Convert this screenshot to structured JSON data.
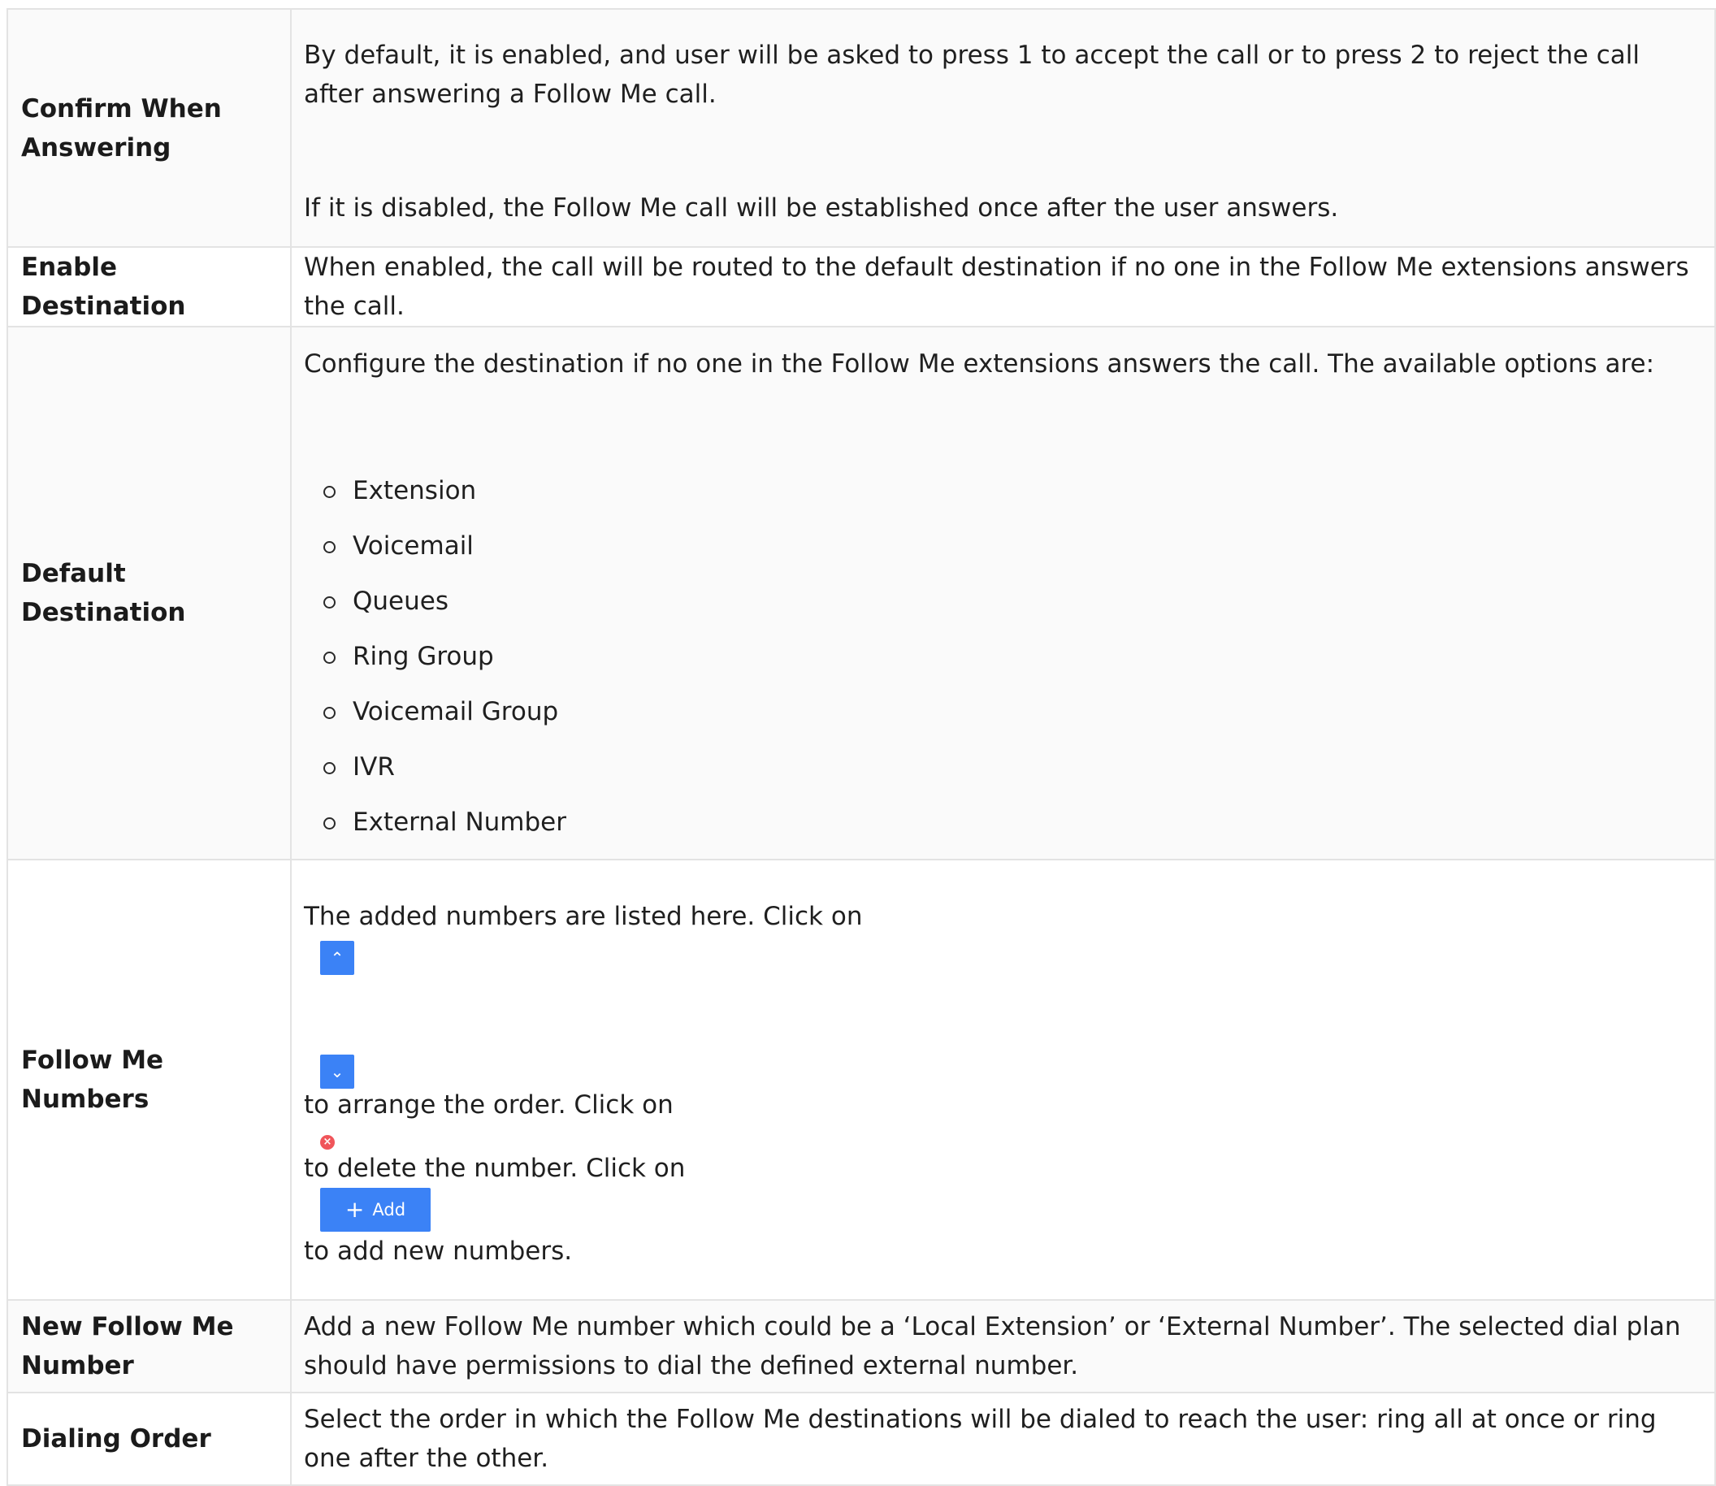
{
  "rows": [
    {
      "label": "Confirm When Answering",
      "paragraphs": [
        "By default, it is enabled, and user will be asked to press 1 to accept the call or to press 2 to reject the call after answering a Follow Me call.",
        "If it is disabled, the Follow Me call will be established once after the user answers."
      ]
    },
    {
      "label": "Enable Destination",
      "text": "When enabled, the call will be routed to the default destination if no one in the Follow Me extensions answers the call."
    },
    {
      "label": "Default Destination",
      "intro": "Configure the destination if no one in the Follow Me extensions answers the call. The available options are:",
      "options": [
        "Extension",
        "Voicemail",
        "Queues",
        "Ring Group",
        "Voicemail Group",
        "IVR",
        "External Number"
      ]
    },
    {
      "label": "Follow Me Numbers",
      "text1": "The added numbers are listed here. Click on",
      "text2": "to arrange the order. Click on",
      "text3": "to delete the number. Click on",
      "text4": "to add new numbers.",
      "add_button_label": "Add"
    },
    {
      "label": "New Follow Me Number",
      "text": "Add a new Follow Me number which could be a ‘Local Extension’ or ‘External Number’. The selected dial plan should have permissions to dial the defined external number."
    },
    {
      "label": "Dialing Order",
      "text": "Select the order in which the Follow Me destinations will be dialed to reach the user: ring all at once or ring one after the other."
    }
  ],
  "icons": {
    "move_up": "chevron-up-icon",
    "move_down": "chevron-down-icon",
    "delete": "close-circle-icon",
    "add": "plus-icon"
  },
  "colors": {
    "button_blue": "#3b82f6",
    "delete_red": "#f0555a",
    "border": "#e3e3e3",
    "alt_row_bg": "#fafafa"
  }
}
